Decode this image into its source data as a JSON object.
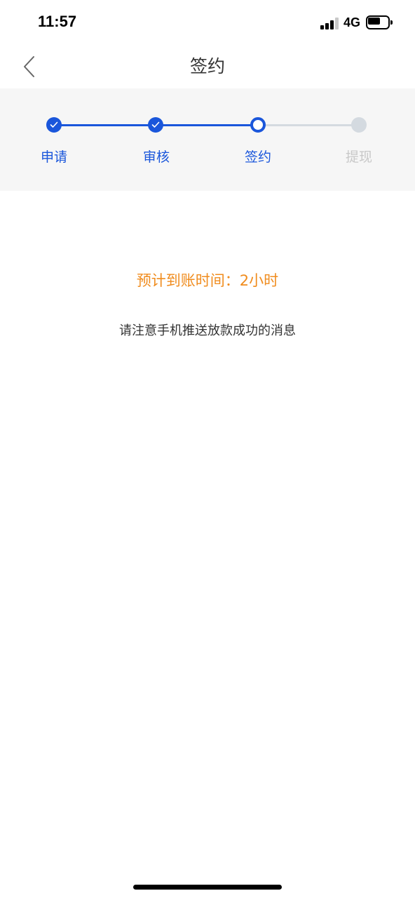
{
  "status_bar": {
    "time": "11:57",
    "network": "4G",
    "battery_level": 0.6
  },
  "nav": {
    "title": "签约",
    "back_icon": "chevron-left-icon"
  },
  "steps": {
    "items": [
      {
        "label": "申请",
        "state": "done"
      },
      {
        "label": "审核",
        "state": "done"
      },
      {
        "label": "签约",
        "state": "current"
      },
      {
        "label": "提现",
        "state": "pending"
      }
    ],
    "active_color": "#1a56db",
    "inactive_color": "#d4dae0",
    "inactive_label_color": "#c8c8c8"
  },
  "content": {
    "arrival_time": "预计到账时间：2小时",
    "notice": "请注意手机推送放款成功的消息"
  },
  "colors": {
    "accent": "#1a56db",
    "highlight": "#f08c1e"
  }
}
